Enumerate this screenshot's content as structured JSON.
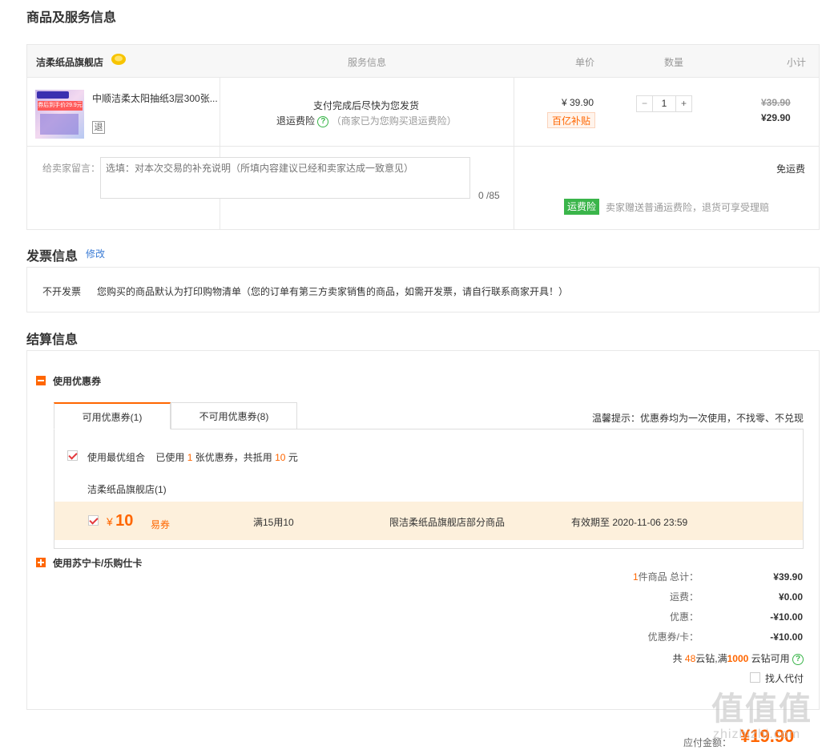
{
  "product_section": {
    "title": "商品及服务信息",
    "store_name": "洁柔纸品旗舰店",
    "columns": {
      "service": "服务信息",
      "unit_price": "单价",
      "quantity": "数量",
      "subtotal": "小计"
    },
    "item": {
      "name": "中顺洁柔太阳抽纸3层300张...",
      "refund_tag": "退",
      "thumb_text_1": "券后到手价29.9元",
      "service_line1": "支付完成后尽快为您发货",
      "return_insurance_label": "退运费险",
      "return_insurance_note": "（商家已为您购买退运费险）",
      "unit_price": "¥ 39.90",
      "subsidy_badge": "百亿补贴",
      "quantity": "1",
      "qty_minus": "−",
      "qty_plus": "+",
      "original_subtotal": "¥39.90",
      "subtotal": "¥29.90"
    },
    "message": {
      "label": "给卖家留言：",
      "placeholder": "选填：对本次交易的补充说明（所填内容建议已经和卖家达成一致意见）",
      "counter": "0 /85"
    },
    "shipping": {
      "free_shipping": "免运费",
      "badge": "运费险",
      "note": "卖家赠送普通运费险，退货可享受理赔"
    }
  },
  "invoice_section": {
    "title": "发票信息",
    "edit_link": "修改",
    "type": "不开发票",
    "description": "您购买的商品默认为打印购物清单（您的订单有第三方卖家销售的商品，如需开发票，请自行联系商家开具！）"
  },
  "settlement_section": {
    "title": "结算信息",
    "coupon_toggle": "使用优惠券",
    "tabs": [
      {
        "label": "可用优惠券(1)"
      },
      {
        "label": "不可用优惠券(8)"
      }
    ],
    "tip": "温馨提示：优惠券均为一次使用，不找零、不兑现",
    "best_combo_label": "使用最优组合",
    "used_prefix": "已使用",
    "used_count": "1",
    "used_mid": "张优惠券，共抵用",
    "used_amount": "10",
    "used_suffix": "元",
    "store_group": "洁柔纸品旗舰店(1)",
    "coupon": {
      "currency": "¥",
      "amount": "10",
      "type": "易券",
      "condition": "满15用10",
      "scope": "限洁柔纸品旗舰店部分商品",
      "validity": "有效期至 2020-11-06 23:59"
    },
    "card_toggle": "使用苏宁卡/乐购仕卡"
  },
  "summary": {
    "items_count": "1",
    "items_label": "件商品 总计：",
    "items_total": "¥39.90",
    "shipping_label": "运费：",
    "shipping_value": "¥0.00",
    "discount_label": "优惠：",
    "discount_value": "-¥10.00",
    "coupon_card_label": "优惠券/卡：",
    "coupon_card_value": "-¥10.00",
    "diamond_prefix": "共",
    "diamond_count": "48",
    "diamond_mid": "云钻,满",
    "diamond_threshold": "1000",
    "diamond_suffix": "云钻可用",
    "proxy_pay": "找人代付",
    "payable_label": "应付金额：",
    "payable_value": "¥19.90"
  },
  "watermark": {
    "text": "值值值",
    "domain": "zhizhizhi.com"
  },
  "colors": {
    "accent": "#ff6600",
    "green": "#3ab54a",
    "coupon_bg": "#fdf0dc",
    "link": "#3a7bd5"
  }
}
